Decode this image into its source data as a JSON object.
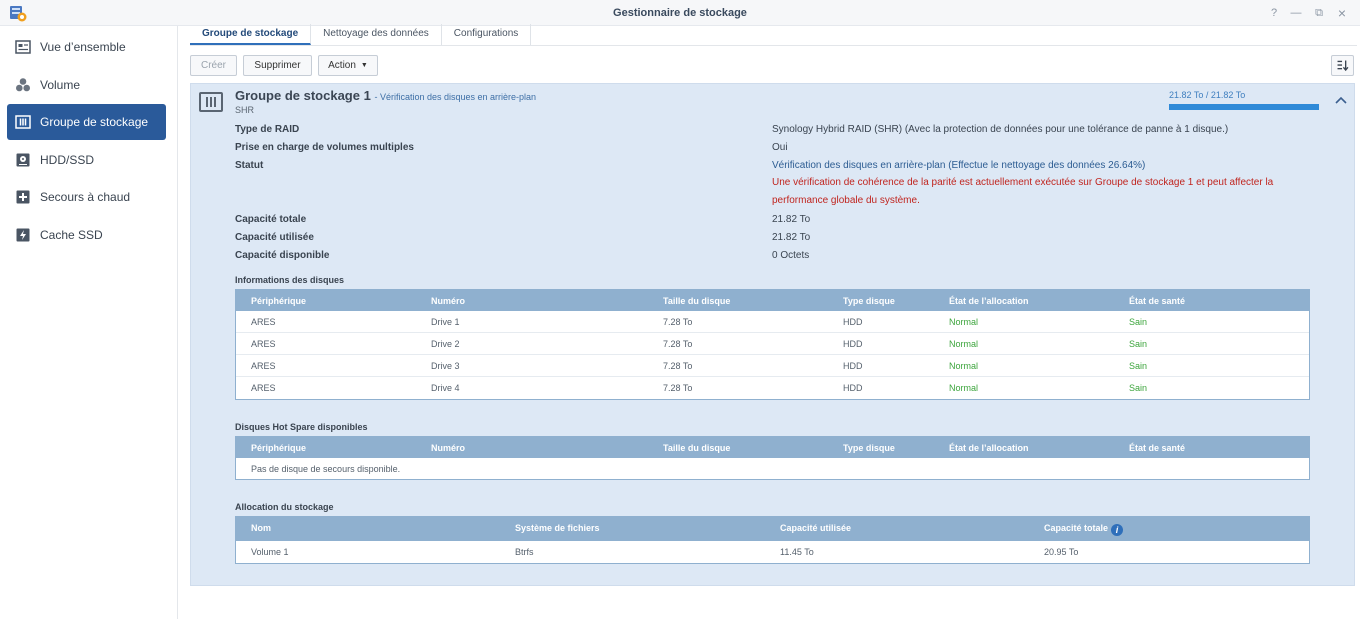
{
  "window": {
    "title": "Gestionnaire de stockage"
  },
  "sidebar": {
    "items": [
      {
        "label": "Vue d’ensemble",
        "icon": "overview-icon"
      },
      {
        "label": "Volume",
        "icon": "volume-icon"
      },
      {
        "label": "Groupe de stockage",
        "icon": "storage-pool-icon",
        "active": true
      },
      {
        "label": "HDD/SSD",
        "icon": "hdd-icon"
      },
      {
        "label": "Secours à chaud",
        "icon": "hot-spare-icon"
      },
      {
        "label": "Cache SSD",
        "icon": "ssd-cache-icon"
      }
    ]
  },
  "tabs": [
    {
      "label": "Groupe de stockage",
      "active": true
    },
    {
      "label": "Nettoyage des données"
    },
    {
      "label": "Configurations"
    }
  ],
  "toolbar": {
    "create": "Créer",
    "delete": "Supprimer",
    "action": "Action"
  },
  "pool": {
    "name": "Groupe de stockage 1",
    "status_sub": "- Vérification des disques en arrière-plan",
    "raid_short": "SHR",
    "capacity_text": "21.82 To / 21.82 To",
    "capacity_fraction": 1.0,
    "fields": {
      "raid_type_label": "Type de RAID",
      "raid_type_value": "Synology Hybrid RAID (SHR) (Avec la protection de données pour une tolérance de panne à 1 disque.)",
      "multi_vol_label": "Prise en charge de volumes multiples",
      "multi_vol_value": "Oui",
      "status_label": "Statut",
      "status_value": "Vérification des disques en arrière-plan (Effectue le nettoyage des données 26.64%)",
      "status_warning": "Une vérification de cohérence de la parité est actuellement exécutée sur Groupe de stockage 1 et peut affecter la performance globale du système.",
      "total_label": "Capacité totale",
      "total_value": "21.82 To",
      "used_label": "Capacité utilisée",
      "used_value": "21.82 To",
      "free_label": "Capacité disponible",
      "free_value": "0 Octets"
    }
  },
  "disks": {
    "title": "Informations des disques",
    "headers": [
      "Périphérique",
      "Numéro",
      "Taille du disque",
      "Type disque",
      "État de l’allocation",
      "État de santé"
    ],
    "rows": [
      [
        "ARES",
        "Drive 1",
        "7.28 To",
        "HDD",
        "Normal",
        "Sain"
      ],
      [
        "ARES",
        "Drive 2",
        "7.28 To",
        "HDD",
        "Normal",
        "Sain"
      ],
      [
        "ARES",
        "Drive 3",
        "7.28 To",
        "HDD",
        "Normal",
        "Sain"
      ],
      [
        "ARES",
        "Drive 4",
        "7.28 To",
        "HDD",
        "Normal",
        "Sain"
      ]
    ]
  },
  "hotspare": {
    "title": "Disques Hot Spare disponibles",
    "headers": [
      "Périphérique",
      "Numéro",
      "Taille du disque",
      "Type disque",
      "État de l’allocation",
      "État de santé"
    ],
    "empty": "Pas de disque de secours disponible."
  },
  "allocation": {
    "title": "Allocation du stockage",
    "headers": [
      "Nom",
      "Système de fichiers",
      "Capacité utilisée",
      "Capacité totale"
    ],
    "rows": [
      [
        "Volume 1",
        "Btrfs",
        "11.45 To",
        "20.95 To"
      ]
    ]
  }
}
